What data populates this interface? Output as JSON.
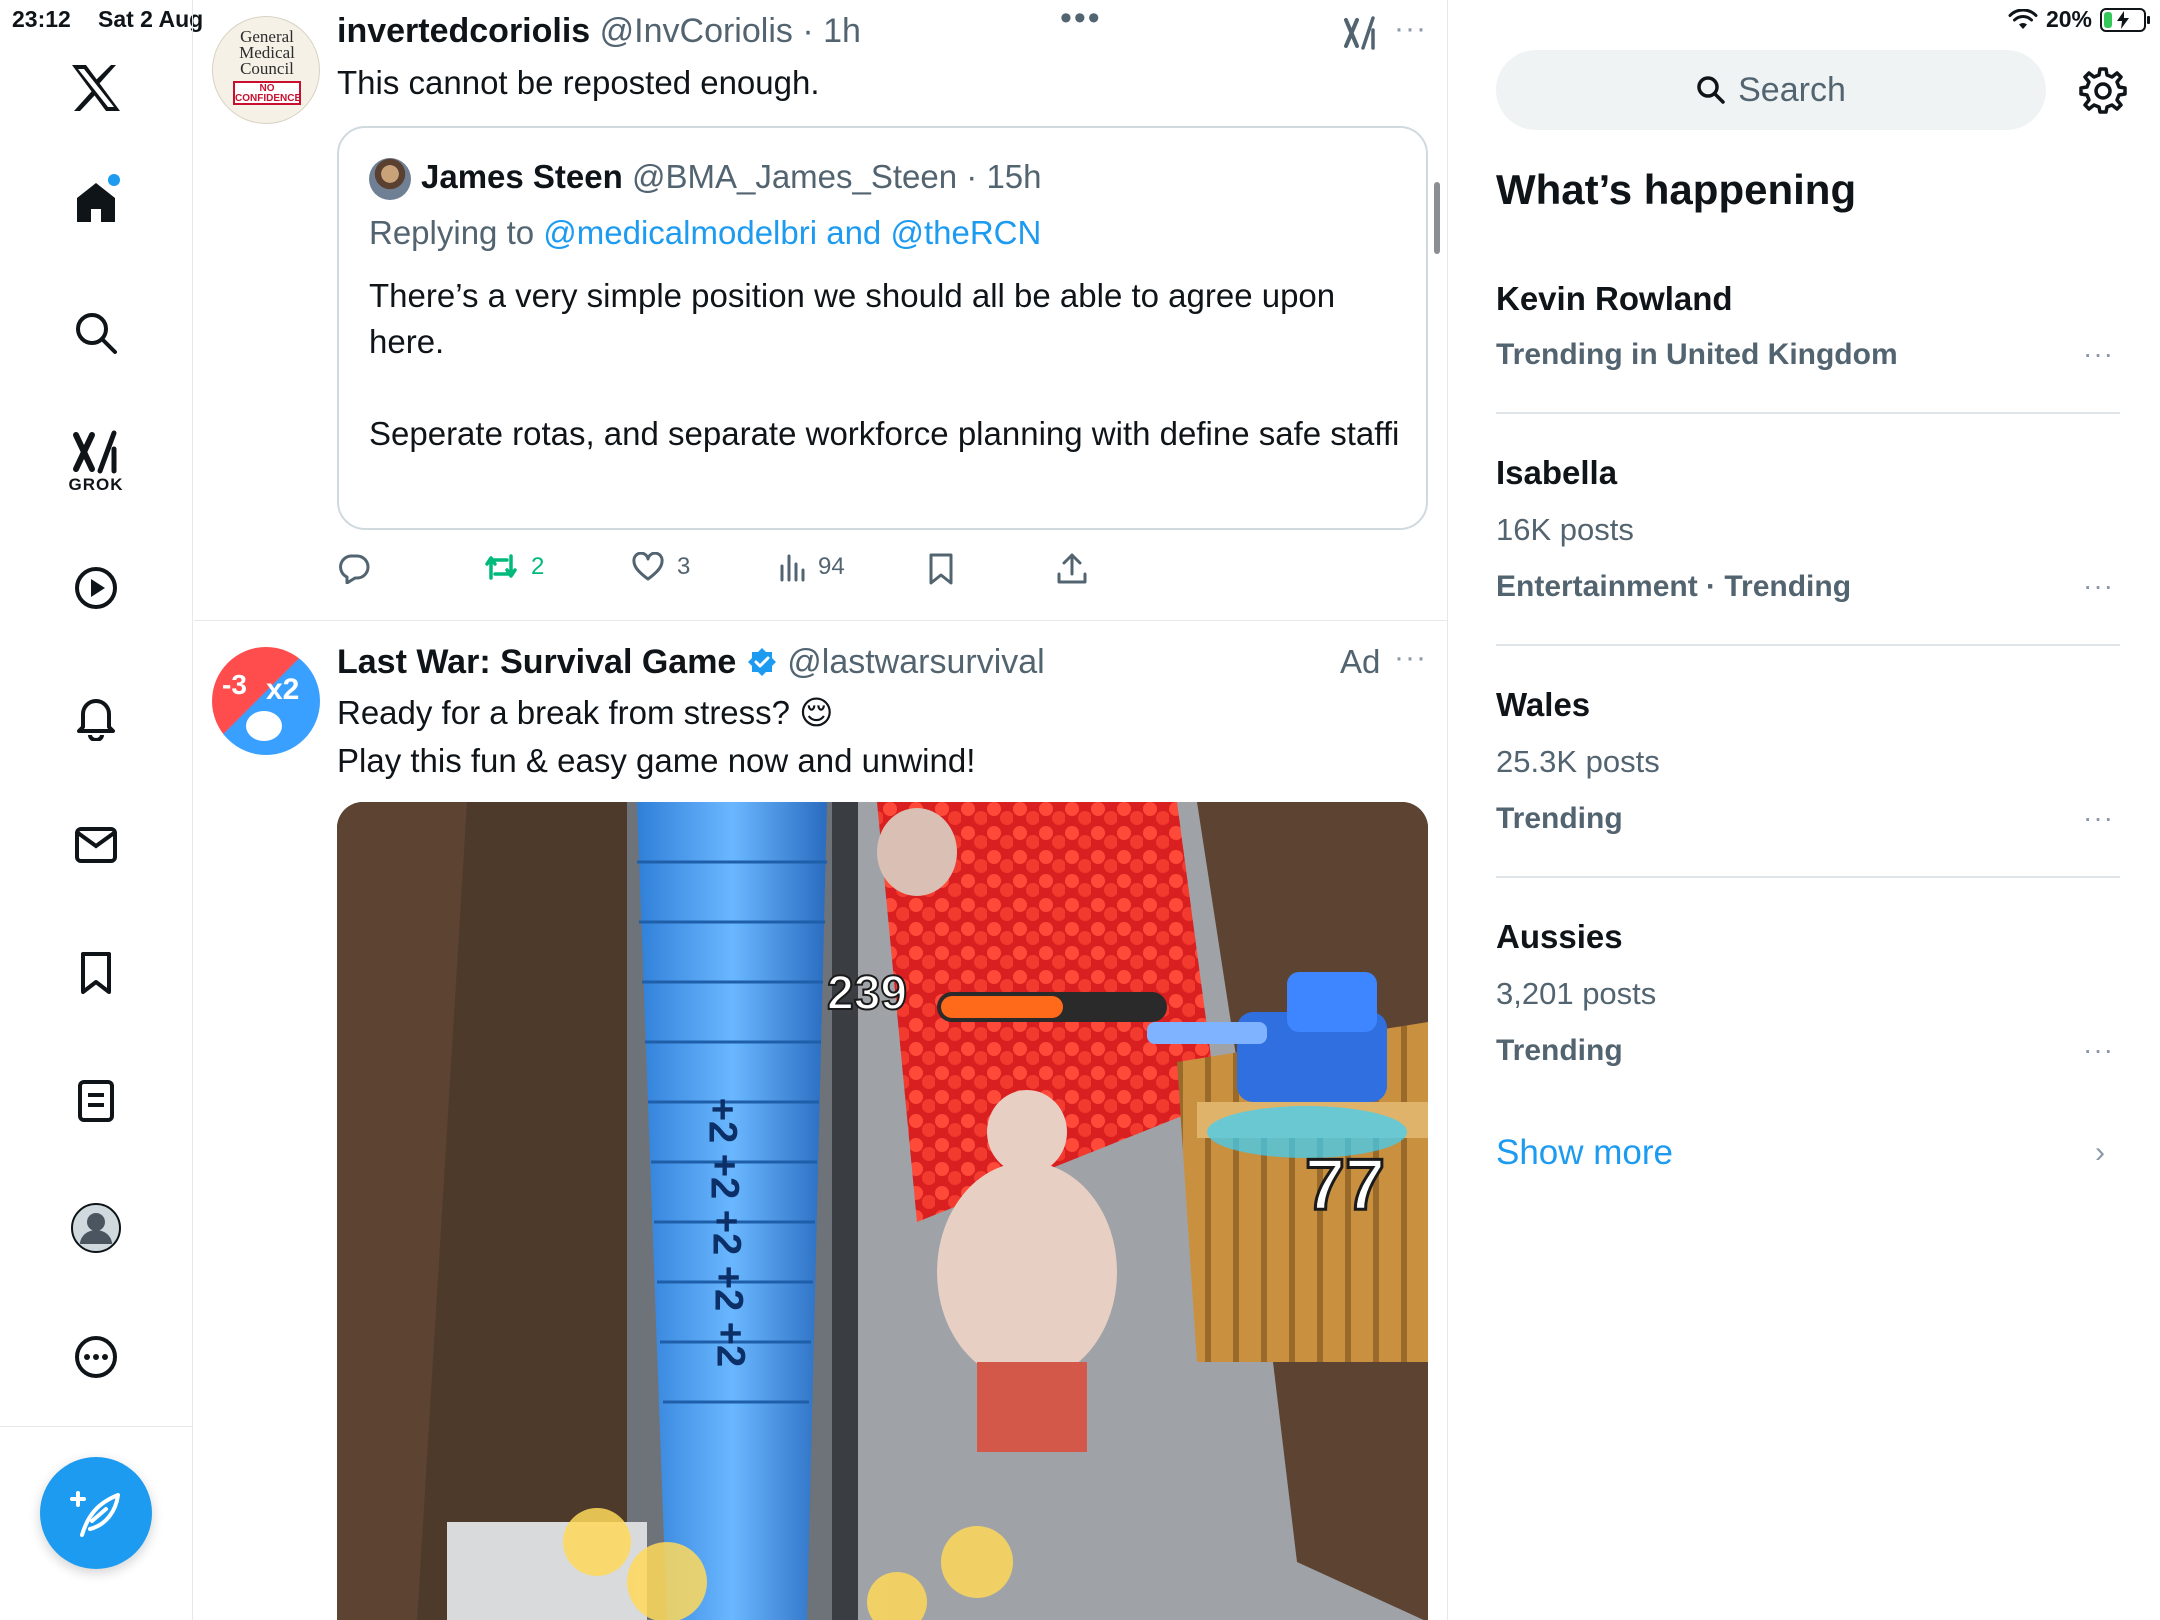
{
  "status_bar": {
    "time": "23:12",
    "date": "Sat 2 Aug",
    "battery": "20%",
    "battery_level": 0.2
  },
  "nav": {
    "items": [
      "x-logo",
      "home",
      "explore",
      "grok",
      "video",
      "notifications",
      "messages",
      "bookmarks",
      "lists",
      "profile",
      "more"
    ],
    "grok_label": "GROK"
  },
  "tweet1": {
    "avatar_lines": [
      "General",
      "Medical",
      "Council"
    ],
    "avatar_stamp": [
      "NO",
      "CONFIDENCE"
    ],
    "name": "invertedcoriolis",
    "handle": "@InvCoriolis",
    "time": "· 1h",
    "text": "This cannot be reposted enough.",
    "quote": {
      "name": "James Steen",
      "handle": "@BMA_James_Steen",
      "time": "· 15h",
      "replying_prefix": "Replying to",
      "replying_users": "@medicalmodelbri and @theRCN",
      "body_p1": "There’s a very simple position we should all be able to agree upon here.",
      "body_p2": "Seperate rotas, and separate workforce planning with define safe staffing levels based on demand and acuity, without reference to t..."
    },
    "actions": {
      "reposts": "2",
      "likes": "3",
      "views": "94"
    }
  },
  "tweet2": {
    "name": "Last War: Survival Game",
    "handle": "@lastwarsurvival",
    "ad_label": "Ad",
    "text_line1": "Ready for a break from stress? 😌",
    "text_line2": "Play this fun & easy game now and unwind!",
    "avatar_text": [
      "-3",
      "x2"
    ],
    "media": {
      "health_value": "239",
      "health_fraction": 0.55,
      "crate_value": "77",
      "stair_labels": [
        "+2",
        "+2",
        "+2",
        "+2",
        "+2"
      ]
    }
  },
  "sidebar": {
    "search_placeholder": "Search",
    "title": "What’s happening",
    "trends": [
      {
        "name": "Kevin Rowland",
        "context": "Trending in United Kingdom"
      },
      {
        "name": "Isabella",
        "posts": "16K posts",
        "context": "Entertainment · Trending"
      },
      {
        "name": "Wales",
        "posts": "25.3K posts",
        "context": "Trending"
      },
      {
        "name": "Aussies",
        "posts": "3,201 posts",
        "context": "Trending"
      }
    ],
    "show_more": "Show more"
  },
  "colors": {
    "accent": "#1d9bf0",
    "repost_green": "#00ba7c",
    "text_secondary": "#536471"
  }
}
